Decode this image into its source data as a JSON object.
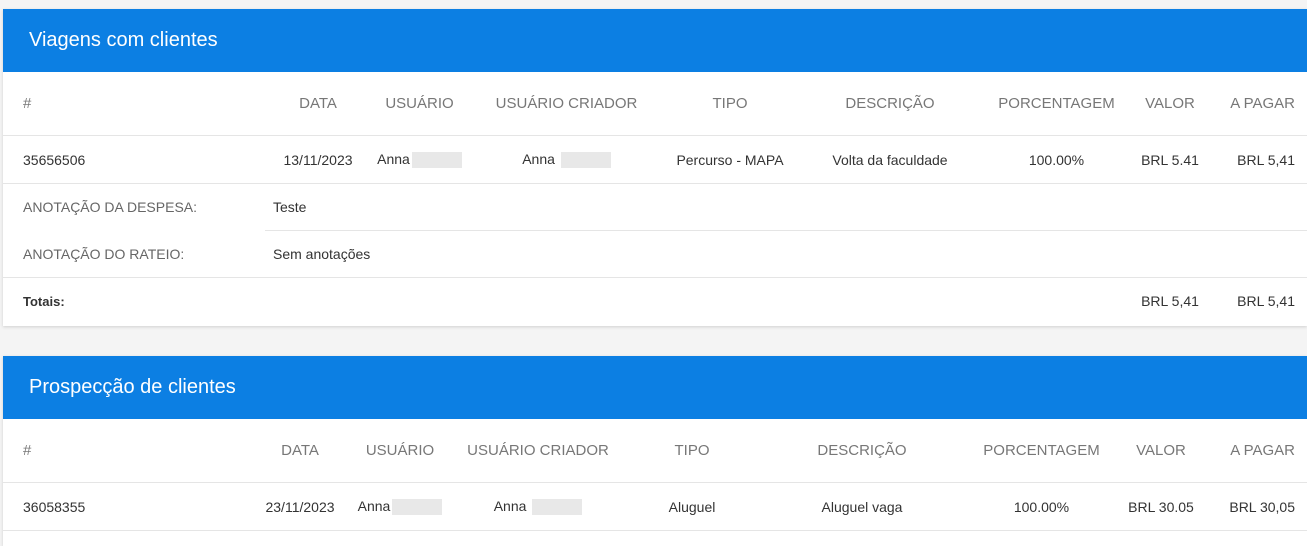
{
  "section1": {
    "title": "Viagens com clientes",
    "headers": {
      "id": "#",
      "date": "DATA",
      "user": "USUÁRIO",
      "creator": "USUÁRIO CRIADOR",
      "type": "TIPO",
      "description": "DESCRIÇÃO",
      "percent": "PORCENTAGEM",
      "value": "VALOR",
      "to_pay": "A PAGAR"
    },
    "row": {
      "id": "35656506",
      "date": "13/11/2023",
      "user": "Anna",
      "creator": "Anna",
      "type": "Percurso - MAPA",
      "description": "Volta da faculdade",
      "percent": "100.00%",
      "value": "BRL 5.41",
      "to_pay": "BRL 5,41"
    },
    "expense_note_label": "ANOTAÇÃO DA DESPESA:",
    "expense_note_value": "Teste",
    "split_note_label": "ANOTAÇÃO DO RATEIO:",
    "split_note_value": "Sem anotações",
    "totals_label": "Totais:",
    "totals_value": "BRL 5,41",
    "totals_to_pay": "BRL 5,41"
  },
  "section2": {
    "title": "Prospecção de clientes",
    "headers": {
      "id": "#",
      "date": "DATA",
      "user": "USUÁRIO",
      "creator": "USUÁRIO CRIADOR",
      "type": "TIPO",
      "description": "DESCRIÇÃO",
      "percent": "PORCENTAGEM",
      "value": "VALOR",
      "to_pay": "A PAGAR"
    },
    "row": {
      "id": "36058355",
      "date": "23/11/2023",
      "user": "Anna",
      "creator": "Anna",
      "type": "Aluguel",
      "description": "Aluguel vaga",
      "percent": "100.00%",
      "value": "BRL 30.05",
      "to_pay": "BRL 30,05"
    }
  },
  "colors": {
    "header_blue": "#0c7fe3",
    "border": "#e5e5e5"
  }
}
